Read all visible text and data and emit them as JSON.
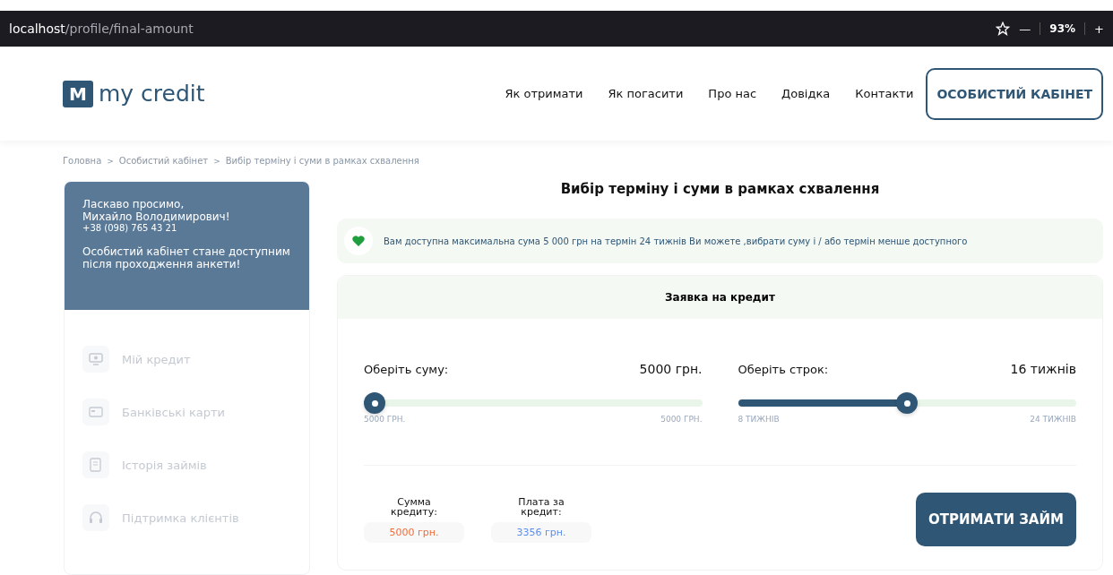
{
  "browser": {
    "url_host": "localhost",
    "url_path": "/profile/final-amount",
    "zoom": "93%",
    "zoom_out": "—",
    "zoom_in": "+"
  },
  "header": {
    "logo_mark": "M",
    "logo_text": "my credit",
    "nav": [
      "Як отримати",
      "Як погасити",
      "Про нас",
      "Довідка",
      "Контакти"
    ],
    "cabinet_button": "ОСОБИСТИЙ КАБІНЕТ"
  },
  "breadcrumbs": [
    "Головна",
    "Особистий кабінет",
    "Вибір терміну і суми в рамках схвалення"
  ],
  "breadcrumb_separator": ">",
  "sidebar": {
    "greeting": "Ласкаво просимо,",
    "name": "Михайло Володимирович!",
    "phone": "+38 (098) 765 43 21",
    "notice": "Особистий кабінет стане доступним після проходження анкети!",
    "items": [
      {
        "label": "Мій кредит",
        "kind": "monitor",
        "disabled": true
      },
      {
        "label": "Банківські карти",
        "kind": "card",
        "disabled": true
      },
      {
        "label": "Історія займів",
        "kind": "document",
        "disabled": true
      },
      {
        "label": "Підтримка клієнтів",
        "kind": "headset",
        "disabled": true
      }
    ]
  },
  "main": {
    "title": "Вибір терміну і суми в рамках схвалення",
    "info": "Вам доступна максимальна сума 5 000 грн на термін 24 тижнів Ви можете ,вибрати суму і / або термін менше доступного",
    "card_title": "Заявка на кредит",
    "sliders": [
      {
        "label": "Оберіть суму:",
        "value": "5000 грн.",
        "level": 0,
        "min_label": "5000 ГРН.",
        "max_label": "5000 ГРН."
      },
      {
        "label": "Оберіть строк:",
        "value": "16 тижнів",
        "level": 0.5,
        "min_label": "8 ТИЖНІВ",
        "max_label": "24 ТИЖНІВ"
      }
    ],
    "summary": [
      {
        "label": "Сумма кредиту:",
        "value": "5000 грн.",
        "color": "#f26b3a"
      },
      {
        "label": "Плата за кредит:",
        "value": "3356 грн.",
        "color": "#5b8def"
      }
    ],
    "submit_button": "ОТРИМАТИ ЗАЙМ"
  }
}
